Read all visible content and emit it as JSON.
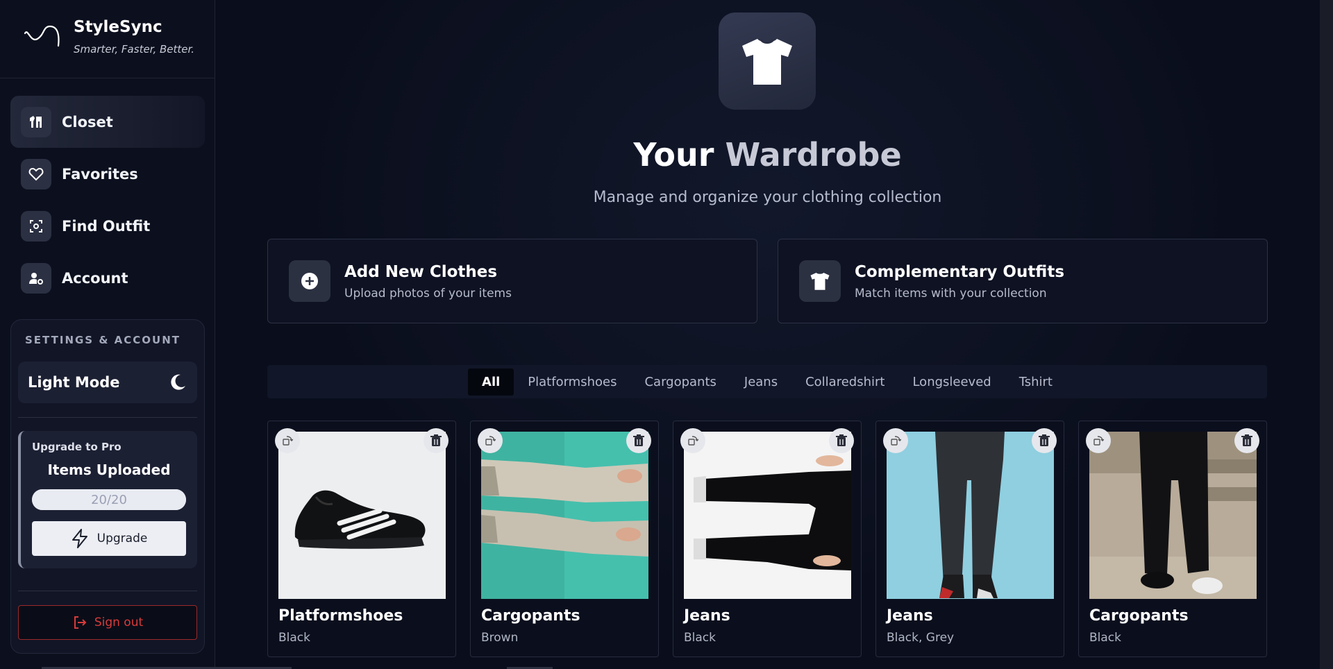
{
  "brand": {
    "name": "StyleSync",
    "tagline": "Smarter, Faster, Better."
  },
  "nav": {
    "items": [
      {
        "label": "Closet",
        "icon": "wardrobe-icon",
        "active": true
      },
      {
        "label": "Favorites",
        "icon": "heart-icon",
        "active": false
      },
      {
        "label": "Find Outfit",
        "icon": "scan-icon",
        "active": false
      },
      {
        "label": "Account",
        "icon": "user-gear-icon",
        "active": false
      }
    ]
  },
  "settings": {
    "title": "SETTINGS & ACCOUNT",
    "mode_label": "Light Mode",
    "mode_icon": "moon-icon",
    "upgrade": {
      "title": "Upgrade to Pro",
      "items_label": "Items Uploaded",
      "count_text": "20/20",
      "progress_fraction": 1.0,
      "button_label": "Upgrade"
    },
    "signout_label": "Sign out"
  },
  "hero": {
    "title_part1": "Your ",
    "title_part2": "Wardrobe",
    "subtitle": "Manage and organize your clothing collection"
  },
  "actions": [
    {
      "title": "Add New Clothes",
      "subtitle": "Upload photos of your items",
      "icon": "plus-circle-icon"
    },
    {
      "title": "Complementary Outfits",
      "subtitle": "Match items with your collection",
      "icon": "tshirt-icon"
    }
  ],
  "filters": [
    "All",
    "Platformshoes",
    "Cargopants",
    "Jeans",
    "Collaredshirt",
    "Longsleeved",
    "Tshirt"
  ],
  "active_filter": "All",
  "items": [
    {
      "category": "Platformshoes",
      "color": "Black"
    },
    {
      "category": "Cargopants",
      "color": "Brown"
    },
    {
      "category": "Jeans",
      "color": "Black"
    },
    {
      "category": "Jeans",
      "color": "Black, Grey"
    },
    {
      "category": "Cargopants",
      "color": "Black"
    }
  ],
  "colors": {
    "background": "#0a0e1c",
    "sidebar": "#0c101e",
    "danger": "#d83b3b"
  }
}
